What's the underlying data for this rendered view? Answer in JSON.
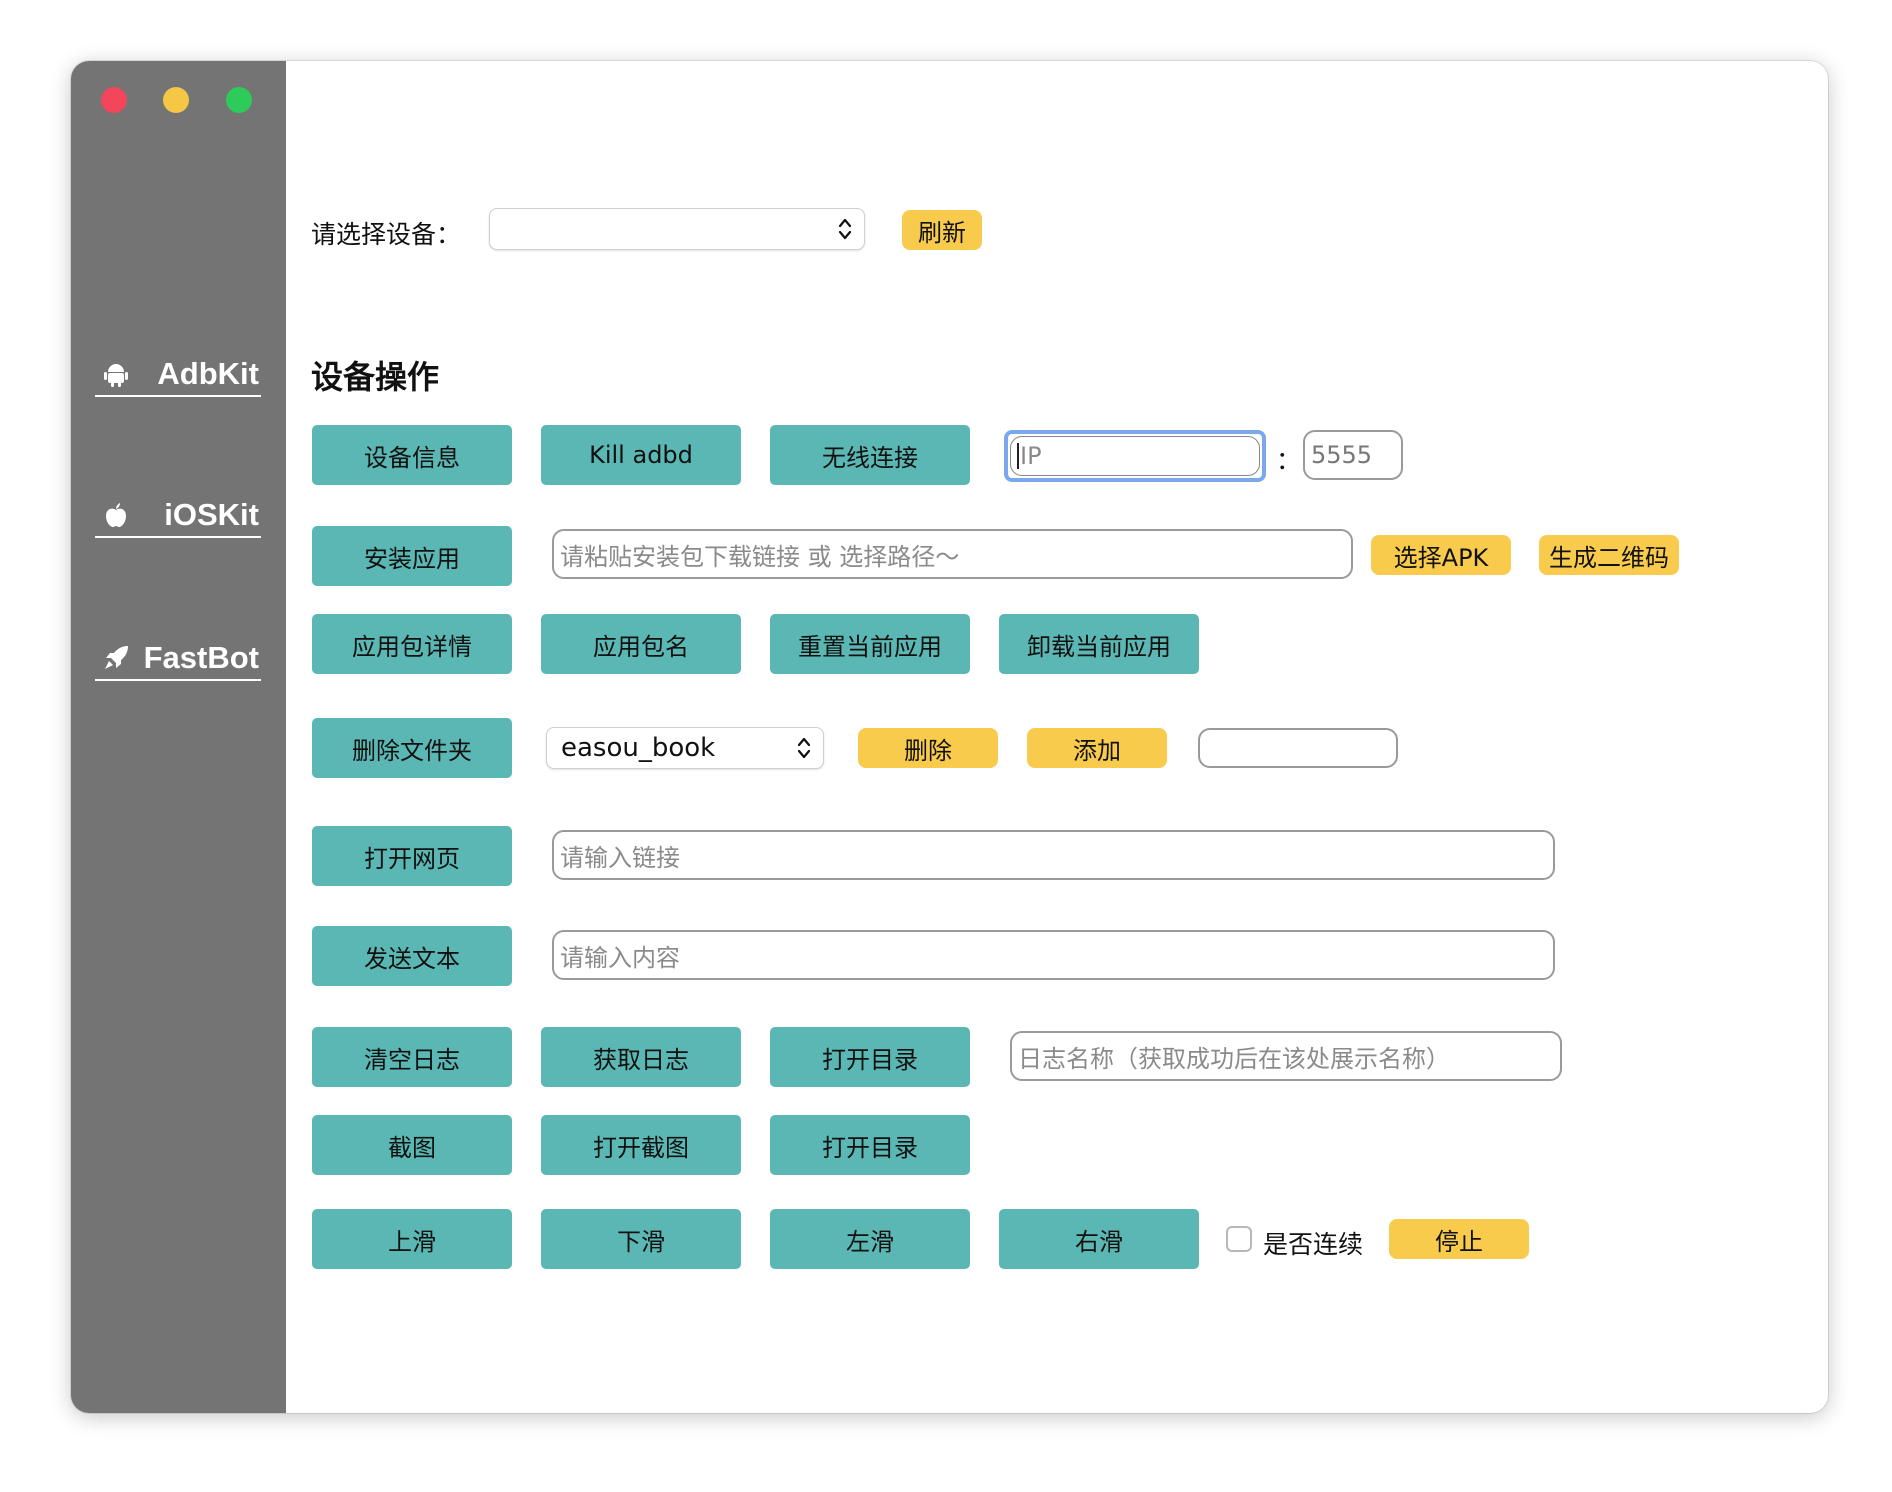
{
  "sidebar": {
    "items": [
      {
        "label": "AdbKit",
        "icon": "android-icon"
      },
      {
        "label": "iOSKit",
        "icon": "apple-icon"
      },
      {
        "label": "FastBot",
        "icon": "rocket-icon"
      }
    ]
  },
  "device": {
    "label": "请选择设备：",
    "selected": "",
    "refresh_label": "刷新"
  },
  "section_title": "设备操作",
  "row1": {
    "device_info": "设备信息",
    "kill_adbd": "Kill adbd",
    "wireless_connect": "无线连接",
    "ip_placeholder": "IP",
    "colon": "：",
    "port_value": "5555"
  },
  "row2": {
    "install_app": "安装应用",
    "apk_placeholder": "请粘贴安装包下载链接 或 选择路径～",
    "choose_apk": "选择APK",
    "qr_code": "生成二维码"
  },
  "row3": {
    "package_details": "应用包详情",
    "package_name": "应用包名",
    "reset_app": "重置当前应用",
    "uninstall_app": "卸载当前应用"
  },
  "row4": {
    "delete_folder": "删除文件夹",
    "folder_selected": "easou_book",
    "delete_label": "删除",
    "add_label": "添加",
    "folder_input": ""
  },
  "row5": {
    "open_web": "打开网页",
    "url_placeholder": "请输入链接"
  },
  "row6": {
    "send_text": "发送文本",
    "text_placeholder": "请输入内容"
  },
  "row7": {
    "clear_log": "清空日志",
    "get_log": "获取日志",
    "open_dir": "打开目录",
    "log_name_placeholder": "日志名称（获取成功后在该处展示名称）"
  },
  "row8": {
    "screenshot": "截图",
    "open_screenshot": "打开截图",
    "open_dir": "打开目录"
  },
  "row9": {
    "swipe_up": "上滑",
    "swipe_down": "下滑",
    "swipe_left": "左滑",
    "swipe_right": "右滑",
    "continuous_label": "是否连续",
    "continuous_checked": false,
    "stop": "停止"
  },
  "colors": {
    "sidebar_bg": "#747474",
    "teal_button": "#5bb7b3",
    "yellow_button": "#f8cb4c",
    "focus_ring": "#7aa8ec"
  }
}
